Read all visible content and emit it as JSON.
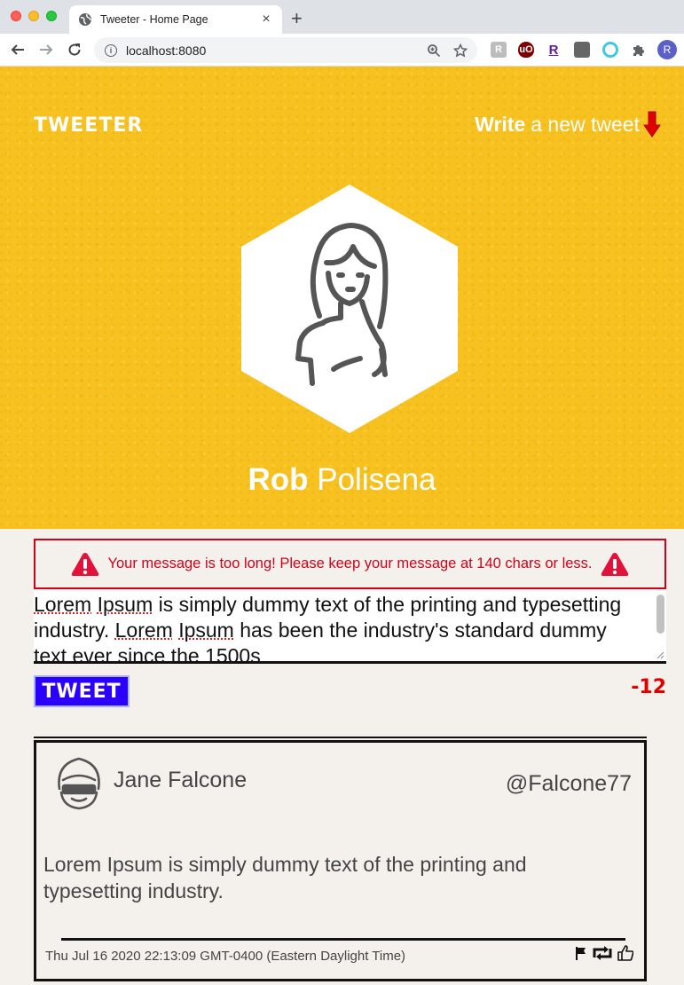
{
  "browser": {
    "tab_title": "Tweeter - Home Page",
    "tab_close": "×",
    "new_tab": "+",
    "url": "localhost:8080",
    "profile_initial": "R",
    "extensions": [
      "R",
      "uO",
      "R"
    ]
  },
  "header": {
    "brand": "TWEETER",
    "compose_bold": "Write",
    "compose_rest": "a new tweet"
  },
  "profile": {
    "first_name": "Rob",
    "last_name": "Polisena"
  },
  "composer": {
    "error_message": "Your message is too long!  Please keep your message at 140 chars or less.",
    "text_parts": [
      {
        "t": "Lorem",
        "sp": true
      },
      {
        "t": " "
      },
      {
        "t": "Ipsum",
        "sp": true
      },
      {
        "t": " is simply dummy text of the printing and typesetting industry. "
      },
      {
        "t": "Lorem",
        "sp": true
      },
      {
        "t": " "
      },
      {
        "t": "Ipsum",
        "sp": true
      },
      {
        "t": " has been the industry's standard dummy text ever since the 1500s"
      }
    ],
    "submit_label": "TWEET",
    "counter": "-12"
  },
  "tweets": [
    {
      "author": "Jane Falcone",
      "handle": "@Falcone77",
      "body": "Lorem Ipsum is simply dummy text of the printing and typesetting industry.",
      "timestamp": "Thu Jul 16 2020 22:13:09 GMT-0400 (Eastern Daylight Time)"
    }
  ],
  "colors": {
    "hero": "#f7c21f",
    "page": "#f4f1ec",
    "error": "#d0021b",
    "tweet_button": "#2b00ff",
    "counter": "#e00000"
  },
  "icons": {
    "tab": "globe-icon",
    "back": "arrow-left-icon",
    "forward": "arrow-right-icon",
    "reload": "reload-icon",
    "zoom": "zoom-icon",
    "bookmark": "star-icon",
    "extensions": "puzzle-icon",
    "compose": "arrow-down-icon",
    "error": "warning-icon",
    "flag": "flag-icon",
    "retweet": "retweet-icon",
    "like": "thumbs-up-icon"
  }
}
